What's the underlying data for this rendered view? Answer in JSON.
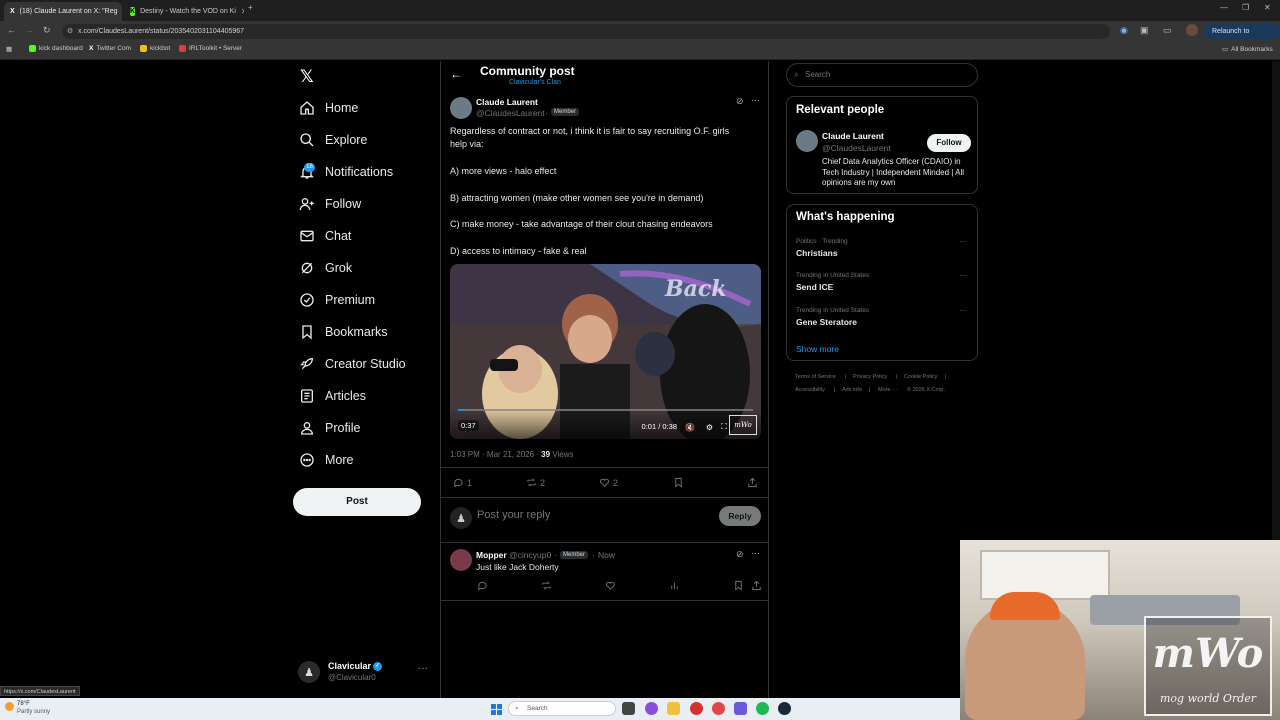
{
  "browser": {
    "tabs": [
      {
        "title": "(18) Claude Laurent on X: \"Reg",
        "favicon": "X"
      },
      {
        "title": "Destiny - Watch the VOD on Ki",
        "favicon": "K"
      }
    ],
    "url": "x.com/ClaudesLaurent/status/2035402031104405967",
    "relaunch_label": "Relaunch to update",
    "bookmarks": [
      "kick dashboard",
      "Twitter Com",
      "kickbot",
      "IRLToolkit • Server"
    ],
    "all_bookmarks": "All Bookmarks",
    "status_url": "https://x.com/ClaudesLaurent"
  },
  "nav": {
    "items": [
      {
        "label": "Home",
        "icon": "home-icon"
      },
      {
        "label": "Explore",
        "icon": "search-icon"
      },
      {
        "label": "Notifications",
        "icon": "bell-icon",
        "badge": "18"
      },
      {
        "label": "Follow",
        "icon": "person-add-icon"
      },
      {
        "label": "Chat",
        "icon": "mail-icon"
      },
      {
        "label": "Grok",
        "icon": "grok-icon"
      },
      {
        "label": "Premium",
        "icon": "verified-icon"
      },
      {
        "label": "Bookmarks",
        "icon": "bookmark-icon"
      },
      {
        "label": "Creator Studio",
        "icon": "rocket-icon"
      },
      {
        "label": "Articles",
        "icon": "article-icon"
      },
      {
        "label": "Profile",
        "icon": "person-icon"
      },
      {
        "label": "More",
        "icon": "more-circle-icon"
      }
    ],
    "post_label": "Post",
    "account": {
      "name": "Clavicular",
      "handle": "@Clavicular0"
    }
  },
  "header": {
    "title": "Community post",
    "community": "Clavicular's Clan"
  },
  "post": {
    "author_name": "Claude Laurent",
    "author_handle": "@ClaudesLaurent",
    "dot": "·",
    "member_badge": "Member",
    "lines": [
      "Regardless of contract or not, i think it is fair to say recruiting O.F. girls",
      "help via:",
      "A) more views - halo effect",
      "B) attracting women (make other women see you're in demand)",
      "C) make money - take advantage of their clout chasing endeavors",
      "D) access to intimacy - fake & real"
    ],
    "video": {
      "remaining": "0:37",
      "time": "0:01 / 0:38",
      "overlay_badge": "mWo"
    },
    "timestamp": "1:03 PM · Mar 21, 2026",
    "views_count": "39",
    "views_label": "Views",
    "stats": {
      "replies": "1",
      "reposts": "2",
      "likes": "2"
    }
  },
  "reply_box": {
    "placeholder": "Post your reply",
    "button": "Reply"
  },
  "replies": [
    {
      "name": "Mopper",
      "handle": "@cincyup0",
      "badge": "Member",
      "time": "Now",
      "text": "Just like Jack Doherty"
    }
  ],
  "sidebar": {
    "search_placeholder": "Search",
    "relevant": {
      "title": "Relevant people",
      "name": "Claude Laurent",
      "handle": "@ClaudesLaurent",
      "follow_label": "Follow",
      "bio": "Chief Data Analytics Officer (CDAIO) in Tech Industry | Independent Minded | All opinions are my own"
    },
    "trends": {
      "title": "What's happening",
      "items": [
        {
          "context": "Politics · Trending",
          "name": "Christians"
        },
        {
          "context": "Trending in United States",
          "name": "Send ICE"
        },
        {
          "context": "Trending in United States",
          "name": "Gene Steratore"
        }
      ],
      "show_more": "Show more"
    },
    "footer": [
      "Terms of Service",
      "|",
      "Privacy Policy",
      "|",
      "Cookie Policy",
      "|",
      "Accessibility",
      "|",
      "Ads info",
      "|",
      "More ···",
      "© 2026 X Corp."
    ]
  },
  "taskbar": {
    "weather_temp": "78°F",
    "weather_desc": "Partly sunny",
    "search_placeholder": "Search"
  },
  "webcam": {
    "logo_big": "mWo",
    "logo_small": "mog world Order"
  },
  "colors": {
    "accent": "#1d9bf0",
    "background": "#000000",
    "border": "#2f3336",
    "muted_text": "#71767b"
  }
}
